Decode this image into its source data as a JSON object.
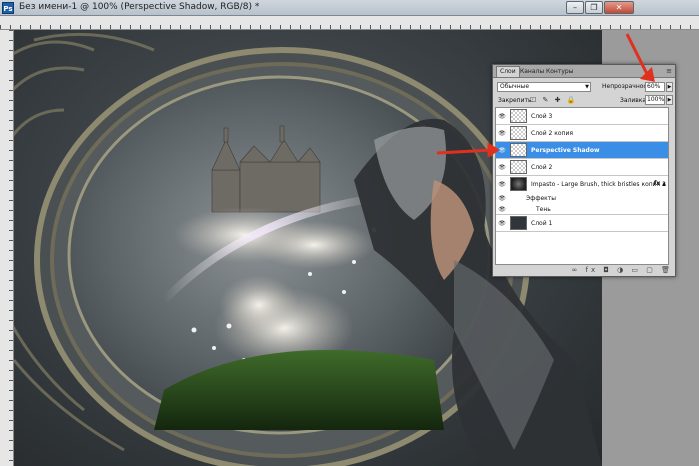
{
  "window": {
    "app_icon": "Ps",
    "title": "Без имени-1 @ 100% (Perspective Shadow, RGB/8) *",
    "buttons": {
      "minimize": "–",
      "restore": "❐",
      "close": "✕"
    }
  },
  "layers_panel": {
    "tabs": [
      "Слои",
      "Каналы",
      "Контуры"
    ],
    "menu_icon": "≡",
    "blend_mode": "Обычные",
    "opacity_label": "Непрозрачность:",
    "opacity_value": "60%",
    "lock_label": "Закрепить:",
    "lock_icons": "☐ ✎ ✚ 🔒",
    "fill_label": "Заливка:",
    "fill_value": "100%",
    "layers": [
      {
        "name": "Слой 3",
        "thumbnail": "transparent",
        "visible": true,
        "selected": false
      },
      {
        "name": "Слой 2 копия",
        "thumbnail": "transparent",
        "visible": true,
        "selected": false
      },
      {
        "name": "Perspective Shadow",
        "thumbnail": "transparent",
        "visible": true,
        "selected": true
      },
      {
        "name": "Слой 2",
        "thumbnail": "transparent",
        "visible": true,
        "selected": false
      },
      {
        "name": "Impasto - Large Brush, thick bristles копия 2",
        "thumbnail": "brush",
        "visible": true,
        "selected": false,
        "fx": "fx"
      },
      {
        "name": "Слой 1",
        "thumbnail": "dark",
        "visible": true,
        "selected": false
      }
    ],
    "effects_label": "Эффекты",
    "effect_shadow": "Тень",
    "bottom_icons": "∞ fx ◘ ◑ ▭ ▢ 🗑"
  },
  "colors": {
    "selection": "#3a8ee6",
    "annotation_arrow": "#e0301e"
  }
}
